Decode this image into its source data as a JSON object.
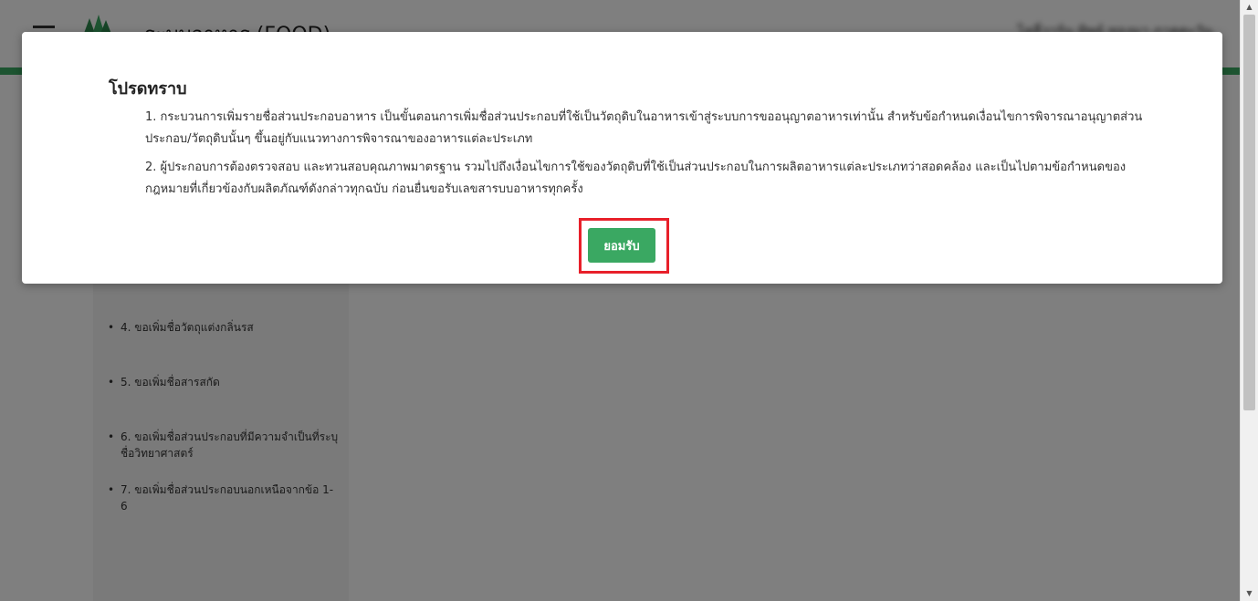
{
  "header": {
    "app_title": "ระบบอาหาร (FOOD)",
    "user_name": "ไลลี่วาร์น ทิพย์ ทองมา ภาคตะวัน"
  },
  "sidebar": {
    "items": [
      {
        "label": "4. ขอเพิ่มชื่อวัตถุแต่งกลิ่นรส"
      },
      {
        "label": "5. ขอเพิ่มชื่อสารสกัด"
      },
      {
        "label": "6. ขอเพิ่มชื่อส่วนประกอบที่มีความจำเป็นที่ระบุชื่อวิทยาศาสตร์"
      },
      {
        "label": "7. ขอเพิ่มชื่อส่วนประกอบนอกเหนือจากข้อ 1-6"
      }
    ]
  },
  "modal": {
    "title": "โปรดทราบ",
    "paragraphs": [
      "1. กระบวนการเพิ่มรายชื่อส่วนประกอบอาหาร เป็นขั้นตอนการเพิ่มชื่อส่วนประกอบที่ใช้เป็นวัตถุดิบในอาหารเข้าสู่ระบบการขออนุญาตอาหารเท่านั้น สำหรับข้อกำหนดเงื่อนไขการพิจารณาอนุญาตส่วนประกอบ/วัตถุดิบนั้นๆ ขึ้นอยู่กับแนวทางการพิจารณาของอาหารแต่ละประเภท",
      "2. ผู้ประกอบการต้องตรวจสอบ และทวนสอบคุณภาพมาตรฐาน รวมไปถึงเงื่อนไขการใช้ของวัตถุดิบที่ใช้เป็นส่วนประกอบในการผลิตอาหารแต่ละประเภทว่าสอดคล้อง และเป็นไปตามข้อกำหนดของกฎหมายที่เกี่ยวข้องกับผลิตภัณฑ์ดังกล่าวทุกฉบับ ก่อนยื่นขอรับเลขสารบบอาหารทุกครั้ง"
    ],
    "accept_label": "ยอมรับ"
  },
  "colors": {
    "accent_green": "#3aa862",
    "highlight_red": "#e8202a",
    "overlay": "rgba(0,0,0,0.5)"
  },
  "icons": {
    "menu": "hamburger-menu-icon",
    "logo": "fda-logo-icon",
    "scroll_up": "scroll-up-arrow-icon",
    "scroll_down": "scroll-down-arrow-icon"
  }
}
